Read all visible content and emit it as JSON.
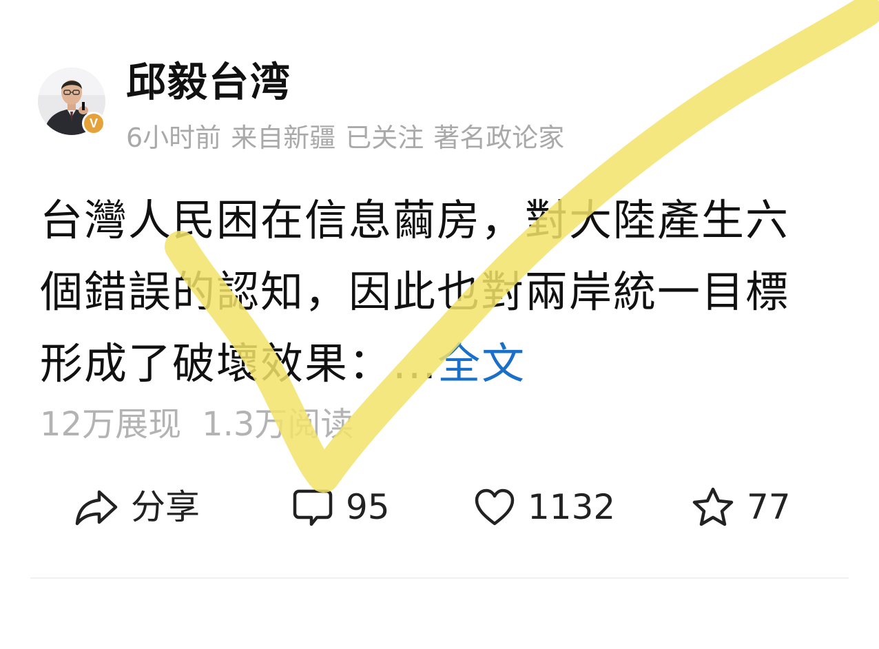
{
  "post": {
    "author": {
      "name": "邱毅台湾",
      "verified_badge": "V",
      "avatar_icon": "user-avatar-photo"
    },
    "meta": {
      "time": "6小时前",
      "location": "来自新疆",
      "follow_status": "已关注",
      "tag": "著名政论家"
    },
    "text_lines": [
      "台灣人民困在信息繭房，對大陸產生六",
      "個錯誤的認知，因此也對兩岸統一目標",
      "形成了破壞效果：..."
    ],
    "read_more_label": "全文",
    "stats": {
      "impressions": "12万展现",
      "reads": "1.3万阅读"
    }
  },
  "actions": {
    "share_label": "分享",
    "comment_count": "95",
    "like_count": "1132",
    "favorite_count": "77"
  },
  "colors": {
    "link": "#1a6fc9",
    "meta_gray": "#a9a9a9",
    "badge": "#e5a23a",
    "check_mark": "#f3e36a"
  },
  "overlay": {
    "type": "hand-drawn check mark",
    "icon": "yellow-checkmark"
  }
}
